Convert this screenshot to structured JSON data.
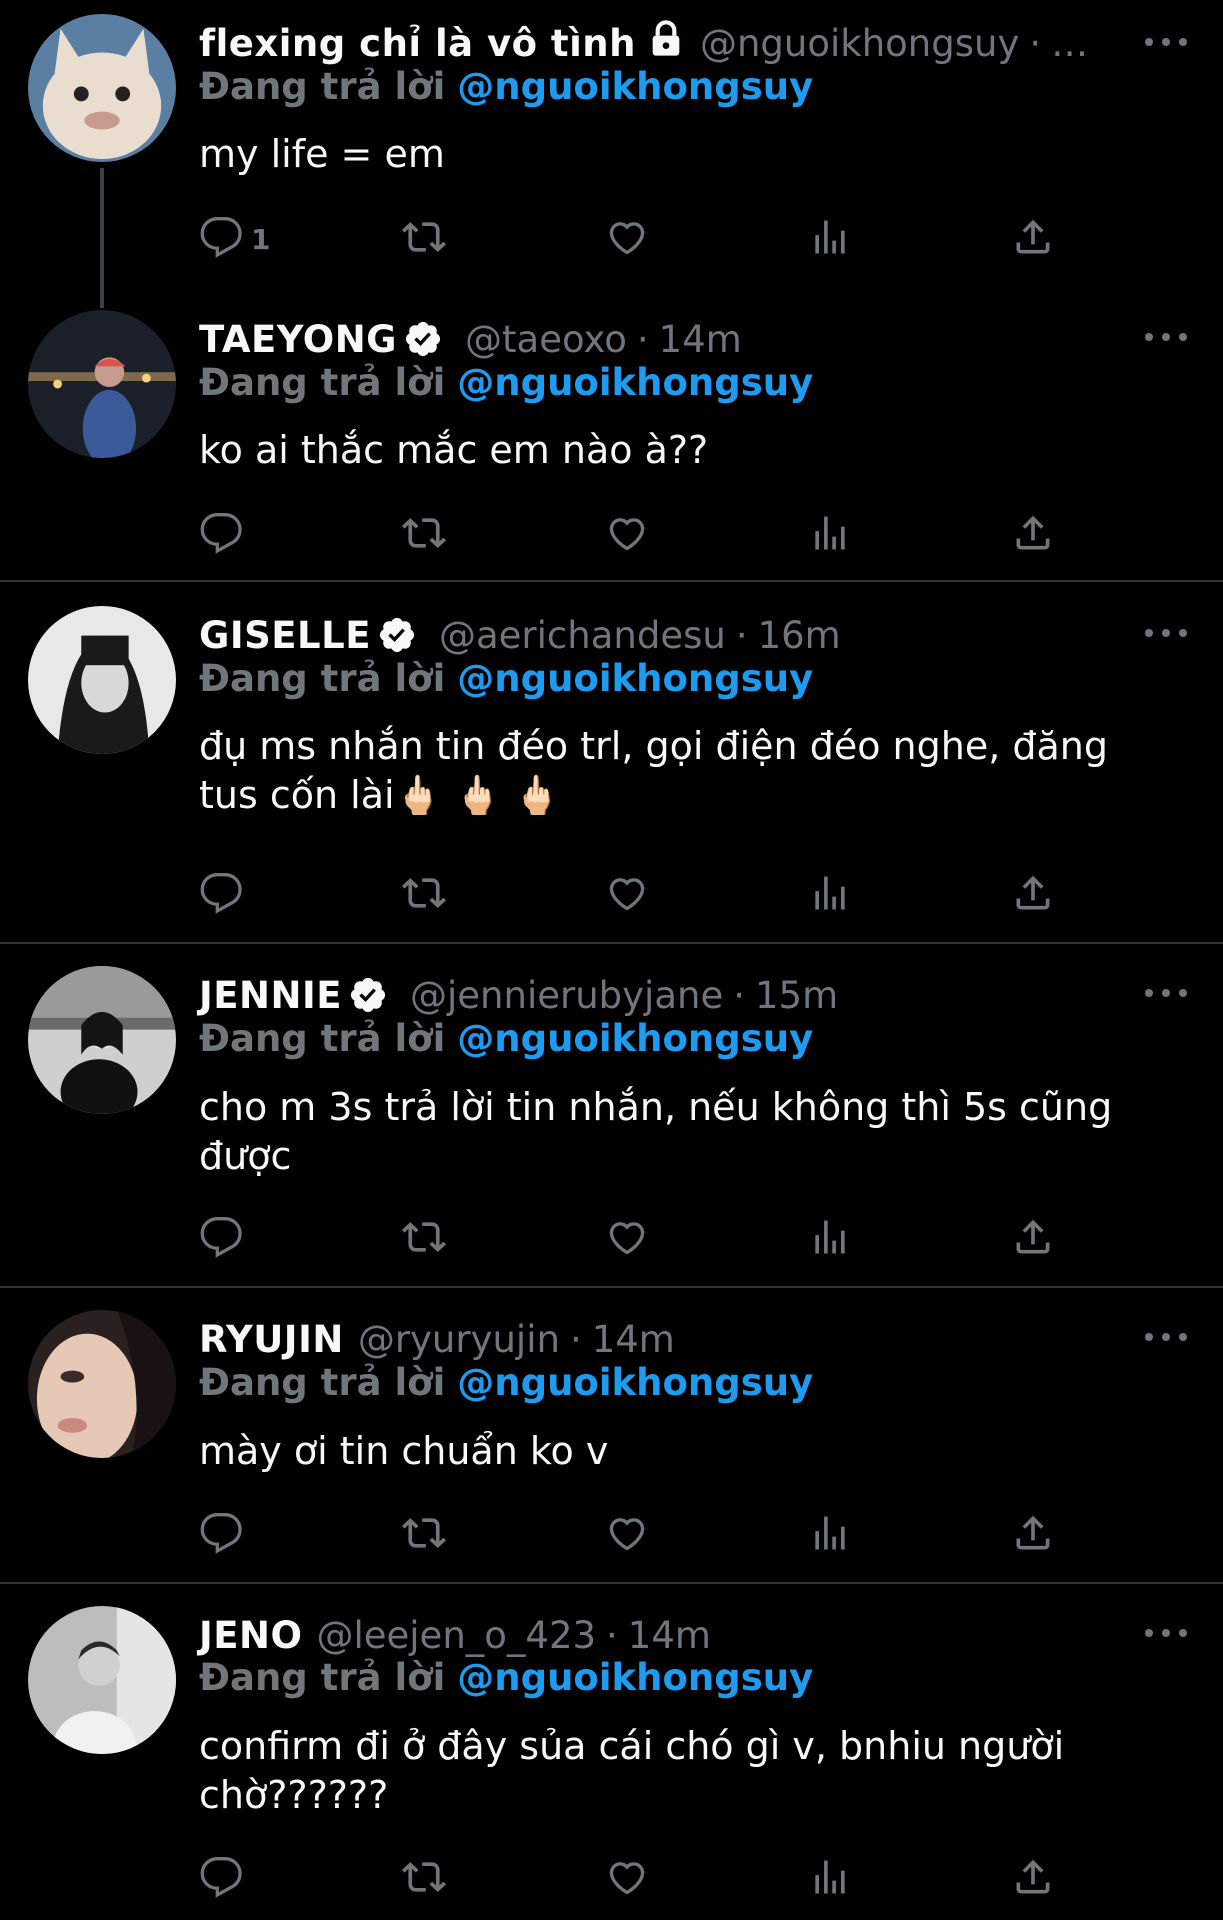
{
  "colors": {
    "background": "#000000",
    "text": "#f7f9f9",
    "muted": "#71767b",
    "link": "#1d9bf0",
    "divider": "#2f3336"
  },
  "reply_prefix": "Đang trả lời",
  "tweets": [
    {
      "name": "flexing chỉ là vô tình",
      "locked": true,
      "verified": false,
      "handle": "@nguoikhongsuy",
      "time": "…",
      "reply_to": "@nguoikhongsuy",
      "text": "my life = em",
      "reply_count": "1"
    },
    {
      "name": "TAEYONG",
      "verified": true,
      "handle": "@taeoxo",
      "time": "14m",
      "reply_to": "@nguoikhongsuy",
      "text": "ko ai thắc mắc em nào à??"
    },
    {
      "name": "GISELLE",
      "verified": true,
      "handle": "@aerichandesu",
      "time": "16m",
      "reply_to": "@nguoikhongsuy",
      "text": "đụ ms nhắn tin đéo trl, gọi điện đéo nghe, đăng tus cốn lài🖕🏻 🖕🏻 🖕🏻"
    },
    {
      "name": "JENNIE",
      "verified": true,
      "handle": "@jennierubyjane",
      "time": "15m",
      "reply_to": "@nguoikhongsuy",
      "text": "cho m 3s trả lời tin nhắn, nếu không thì 5s cũng được"
    },
    {
      "name": "RYUJIN",
      "verified": false,
      "handle": "@ryuryujin",
      "time": "14m",
      "reply_to": "@nguoikhongsuy",
      "text": "mày ơi tin chuẩn ko v"
    },
    {
      "name": "JENO",
      "verified": false,
      "handle": "@leejen_o_423",
      "time": "14m",
      "reply_to": "@nguoikhongsuy",
      "text": "confirm đi ở đây sủa cái chó gì v, bnhiu người chờ??????"
    }
  ],
  "icons": {
    "reply": "reply-icon",
    "retweet": "retweet-icon",
    "like": "heart-icon",
    "views": "views-icon",
    "share": "share-icon",
    "more": "more-icon",
    "verified": "verified-badge-icon",
    "lock": "lock-icon"
  }
}
